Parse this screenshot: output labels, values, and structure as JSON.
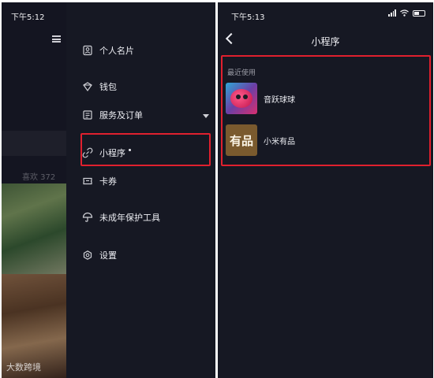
{
  "left_screen": {
    "status": {
      "time": "下午5:12"
    },
    "feed": {
      "likes_label": "喜欢 372"
    },
    "menu": [
      {
        "label": "个人名片",
        "icon": "id-card-icon"
      },
      {
        "label": "钱包",
        "icon": "wallet-icon"
      },
      {
        "label": "服务及订单",
        "icon": "orders-icon",
        "has_dropdown": true
      },
      {
        "label": "小程序",
        "icon": "link-icon",
        "badge_dot": true,
        "highlighted": true
      },
      {
        "label": "卡券",
        "icon": "coupon-icon"
      },
      {
        "label": "未成年保护工具",
        "icon": "umbrella-icon"
      },
      {
        "label": "设置",
        "icon": "gear-icon"
      }
    ]
  },
  "right_screen": {
    "status": {
      "time": "下午5:13"
    },
    "nav": {
      "title": "小程序"
    },
    "recent": {
      "section_label": "最近使用",
      "items": [
        {
          "name": "音跃球球",
          "icon": "music-ball-app-icon"
        },
        {
          "name": "小米有品",
          "icon": "youpin-app-icon",
          "icon_text": "有品"
        }
      ]
    }
  },
  "watermark": "大数跨境",
  "colors": {
    "background": "#161823",
    "highlight": "#e0202e",
    "text": "#ecedf2"
  }
}
